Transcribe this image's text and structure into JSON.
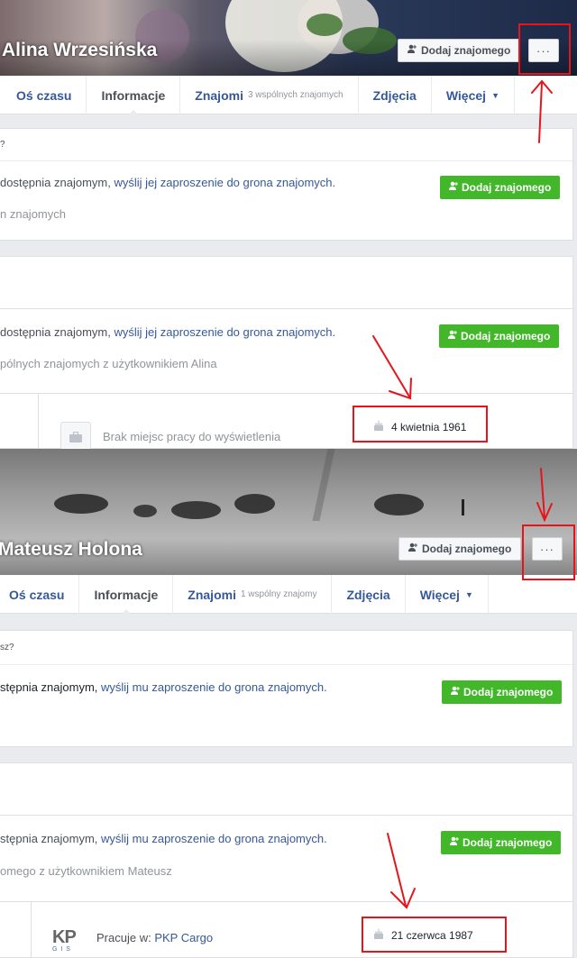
{
  "profile1": {
    "name": "Alina Wrzesińska",
    "add_friend_label": "Dodaj znajomego",
    "more_label": "···",
    "tabs": [
      {
        "label": "Oś czasu",
        "extra": ""
      },
      {
        "label": "Informacje",
        "extra": ""
      },
      {
        "label": "Znajomi",
        "extra": "3 wspólnych znajomych"
      },
      {
        "label": "Zdjęcia",
        "extra": ""
      },
      {
        "label": "Więcej",
        "extra": ""
      }
    ],
    "section1_head": "?",
    "section1_text_a": "dostępnia znajomym, ",
    "section1_link": "wyślij jej zaproszenie do grona znajomych.",
    "section1_muted": "n znajomych",
    "section2_text_a": "dostępnia znajomym, ",
    "section2_link": "wyślij jej zaproszenie do grona znajomych.",
    "section2_muted": "pólnych znajomych z użytkownikiem Alina",
    "work_text": "Brak miejsc pracy do wyświetlenia",
    "birthday": "4 kwietnia 1961"
  },
  "profile2": {
    "name": "Mateusz Holona",
    "add_friend_label": "Dodaj znajomego",
    "more_label": "···",
    "tabs": [
      {
        "label": "Oś czasu",
        "extra": ""
      },
      {
        "label": "Informacje",
        "extra": ""
      },
      {
        "label": "Znajomi",
        "extra": "1 wspólny znajomy"
      },
      {
        "label": "Zdjęcia",
        "extra": ""
      },
      {
        "label": "Więcej",
        "extra": ""
      }
    ],
    "section1_head": "sz?",
    "section1_text_a": "stępnia znajomym, ",
    "section1_link": "wyślij mu zaproszenie do grona znajomych.",
    "section2_text_a": "stępnia znajomym, ",
    "section2_link": "wyślij mu zaproszenie do grona znajomych.",
    "section2_muted": "omego z użytkownikiem Mateusz",
    "work_prefix": "Pracuje w: ",
    "work_link": "PKP Cargo",
    "logo_text": "KP",
    "logo_sub": "G I S",
    "birthday": "21 czerwca 1987"
  },
  "icons": {
    "add_friend": "add-friend-icon",
    "cake": "cake-icon",
    "briefcase": "briefcase-icon"
  },
  "colors": {
    "link": "#365899",
    "green": "#42b72a",
    "annotation": "#e4151b"
  }
}
